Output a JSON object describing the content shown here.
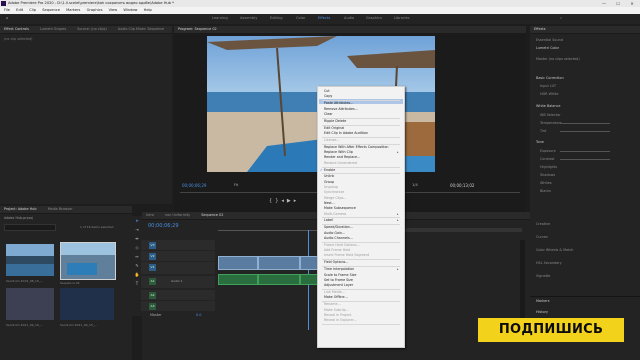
{
  "window": {
    "title": "Adobe Premiere Pro 2020 - D:\\1.ll.sceiel\\premiere\\kak сохранить видео адобе\\Adobe Hub *",
    "minimize": "—",
    "maximize": "☐",
    "close": "✕"
  },
  "menu": [
    "File",
    "Edit",
    "Clip",
    "Sequence",
    "Markers",
    "Graphics",
    "View",
    "Window",
    "Help"
  ],
  "workspaces": [
    "Learning",
    "Assembly",
    "Editing",
    "Color",
    "Effects",
    "Audio",
    "Graphics",
    "Libraries"
  ],
  "active_workspace": "Effects",
  "source_panel": {
    "tabs": [
      "Effect Controls",
      "Lumetri Scopes",
      "Source: (no clips)",
      "Audio Clip Mixer: Sequence"
    ],
    "active_tab": "Effect Controls",
    "hint": "(no clip selected)"
  },
  "program_monitor": {
    "title": "Program: Sequence 02",
    "timecode_left": "00;00;06;29",
    "timecode_right": "00;00;13;02",
    "zoom": "Fit",
    "scale": "1/4"
  },
  "context_menu": {
    "items": [
      {
        "label": "Cut",
        "disabled": false
      },
      {
        "label": "Copy",
        "disabled": false
      },
      {
        "label": "Paste Attributes...",
        "disabled": false,
        "highlighted": true
      },
      {
        "label": "Remove Attributes...",
        "disabled": false
      },
      {
        "label": "Clear",
        "disabled": false
      },
      {
        "label": "Ripple Delete",
        "disabled": false
      },
      {
        "label": "Edit Original",
        "disabled": false
      },
      {
        "label": "Edit Clip In Adobe Audition",
        "disabled": false
      },
      {
        "label": "License...",
        "disabled": true
      },
      {
        "label": "Replace With After Effects Composition",
        "disabled": false
      },
      {
        "label": "Replace With Clip",
        "disabled": false,
        "submenu": true
      },
      {
        "label": "Render and Replace...",
        "disabled": false
      },
      {
        "label": "Restore Unrendered",
        "disabled": true
      },
      {
        "label": "Enable",
        "disabled": false,
        "checked": true
      },
      {
        "label": "Unlink",
        "disabled": false
      },
      {
        "label": "Group",
        "disabled": false
      },
      {
        "label": "Ungroup",
        "disabled": true
      },
      {
        "label": "Synchronize",
        "disabled": true
      },
      {
        "label": "Merge Clips...",
        "disabled": true
      },
      {
        "label": "Nest...",
        "disabled": false
      },
      {
        "label": "Make Subsequence",
        "disabled": false
      },
      {
        "label": "Multi-Camera",
        "disabled": true,
        "submenu": true
      },
      {
        "label": "Label",
        "disabled": false,
        "submenu": true
      },
      {
        "label": "Speed/Duration...",
        "disabled": false
      },
      {
        "label": "Audio Gain...",
        "disabled": false
      },
      {
        "label": "Audio Channels...",
        "disabled": false
      },
      {
        "label": "Frame Hold Options...",
        "disabled": true
      },
      {
        "label": "Add Frame Hold",
        "disabled": true
      },
      {
        "label": "Insert Frame Hold Segment",
        "disabled": true
      },
      {
        "label": "Field Options...",
        "disabled": false
      },
      {
        "label": "Time Interpolation",
        "disabled": false,
        "submenu": true
      },
      {
        "label": "Scale to Frame Size",
        "disabled": false
      },
      {
        "label": "Set to Frame Size",
        "disabled": false
      },
      {
        "label": "Adjustment Layer",
        "disabled": false
      },
      {
        "label": "Link Media...",
        "disabled": true
      },
      {
        "label": "Make Offline...",
        "disabled": false
      },
      {
        "label": "Rename...",
        "disabled": true
      },
      {
        "label": "Make Subclip...",
        "disabled": true
      },
      {
        "label": "Reveal in Project",
        "disabled": true
      },
      {
        "label": "Reveal in Explorer...",
        "disabled": true
      }
    ]
  },
  "project_panel": {
    "tabs": [
      "Project: Adobe Hub",
      "Media Browser"
    ],
    "active_tab": "Project: Adobe Hub",
    "file": "Adobe Hub.prproj",
    "selection": "1 of 16 items selected",
    "items": [
      "Sandrum 2019_08_10_...",
      "Sequence 02",
      "Sandrum 2021_09_10_...",
      "Sandrum 2021_09_15_..."
    ]
  },
  "timeline": {
    "tabs": [
      "Intro",
      "non Uniformity",
      "Sequence 02"
    ],
    "active_tab": "Sequence 02",
    "timecode": "00;00;06;29",
    "tracks": [
      "V3",
      "V2",
      "V1",
      "A1",
      "A2",
      "A3"
    ],
    "master": "Master",
    "master_value": "0.0",
    "audio_label": "Audio 1"
  },
  "lumetri": {
    "title": "Effects",
    "items": [
      "Essential Sound",
      "Lumetri Color",
      "Master (no clips selected)",
      "Basic Correction",
      "Input LUT",
      "HDR White",
      "White Balance",
      "WB Selector",
      "Temperature",
      "Tint",
      "Tone",
      "Exposure",
      "Contrast",
      "Highlights",
      "Shadows",
      "Whites",
      "Blacks",
      "Creative",
      "Curves",
      "Color Wheels & Match",
      "HSL Secondary",
      "Vignette"
    ],
    "bottom": [
      "Markers",
      "History"
    ]
  },
  "banner": {
    "text": "ПОДПИШИСЬ"
  },
  "colors": {
    "accent": "#4a90e2",
    "banner": "#f2d21b",
    "highlight": "#aec7e8"
  }
}
